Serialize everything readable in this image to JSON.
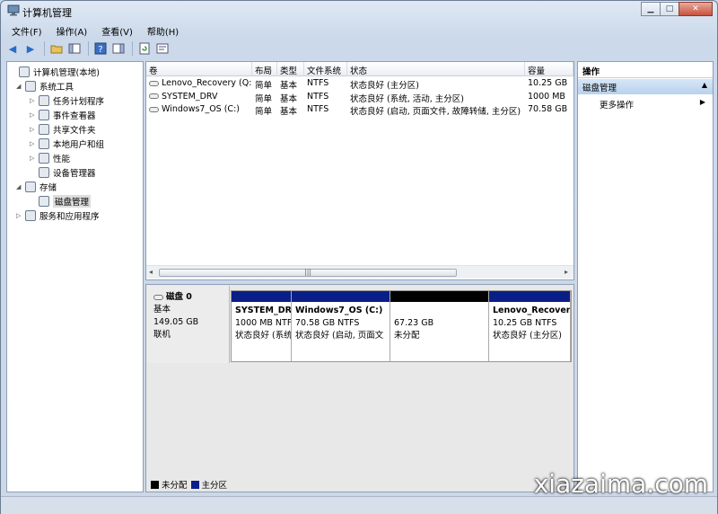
{
  "window": {
    "title": "计算机管理"
  },
  "menu": [
    "文件(F)",
    "操作(A)",
    "查看(V)",
    "帮助(H)"
  ],
  "tree": [
    {
      "label": "计算机管理(本地)",
      "icon": "computer-icon",
      "level": 0,
      "twisty": ""
    },
    {
      "label": "系统工具",
      "icon": "tools-icon",
      "level": 1,
      "twisty": "◢"
    },
    {
      "label": "任务计划程序",
      "icon": "clock-icon",
      "level": 2,
      "twisty": "▷"
    },
    {
      "label": "事件查看器",
      "icon": "event-icon",
      "level": 2,
      "twisty": "▷"
    },
    {
      "label": "共享文件夹",
      "icon": "folder-icon",
      "level": 2,
      "twisty": "▷"
    },
    {
      "label": "本地用户和组",
      "icon": "users-icon",
      "level": 2,
      "twisty": "▷"
    },
    {
      "label": "性能",
      "icon": "performance-icon",
      "level": 2,
      "twisty": "▷"
    },
    {
      "label": "设备管理器",
      "icon": "device-icon",
      "level": 2,
      "twisty": ""
    },
    {
      "label": "存储",
      "icon": "storage-icon",
      "level": 1,
      "twisty": "◢"
    },
    {
      "label": "磁盘管理",
      "icon": "disk-icon",
      "level": 2,
      "twisty": ""
    },
    {
      "label": "服务和应用程序",
      "icon": "services-icon",
      "level": 1,
      "twisty": "▷"
    }
  ],
  "volume_columns": [
    "卷",
    "布局",
    "类型",
    "文件系统",
    "状态",
    "容量"
  ],
  "volumes": [
    {
      "name": "Lenovo_Recovery (Q:)",
      "layout": "简单",
      "type": "基本",
      "fs": "NTFS",
      "status": "状态良好 (主分区)",
      "capacity": "10.25 GB"
    },
    {
      "name": "SYSTEM_DRV",
      "layout": "简单",
      "type": "基本",
      "fs": "NTFS",
      "status": "状态良好 (系统, 活动, 主分区)",
      "capacity": "1000 MB"
    },
    {
      "name": "Windows7_OS (C:)",
      "layout": "简单",
      "type": "基本",
      "fs": "NTFS",
      "status": "状态良好 (启动, 页面文件, 故障转储, 主分区)",
      "capacity": "70.58 GB"
    }
  ],
  "disk": {
    "name": "磁盘 0",
    "type": "基本",
    "size": "149.05 GB",
    "state": "联机"
  },
  "partitions": [
    {
      "name": "SYSTEM_DRV",
      "size": "1000 MB NTFS",
      "status": "状态良好 (系统",
      "bar": "primary"
    },
    {
      "name": "Windows7_OS  (C:)",
      "size": "70.58 GB NTFS",
      "status": "状态良好 (启动, 页面文",
      "bar": "primary"
    },
    {
      "name": "",
      "size": "67.23 GB",
      "status": "未分配",
      "bar": "unallocated"
    },
    {
      "name": "Lenovo_Recover",
      "size": "10.25 GB NTFS",
      "status": "状态良好 (主分区)",
      "bar": "primary"
    }
  ],
  "legend": [
    {
      "label": "未分配",
      "color": "#000000"
    },
    {
      "label": "主分区",
      "color": "#0a1e88"
    }
  ],
  "actions": {
    "header": "操作",
    "section": "磁盘管理",
    "item": "更多操作"
  },
  "watermark": "xiazaima.com"
}
